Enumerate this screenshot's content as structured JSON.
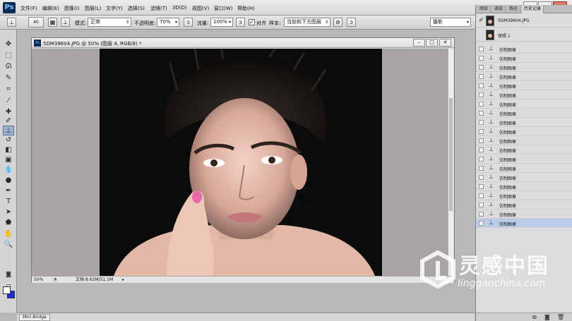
{
  "app": {
    "logo": "Ps",
    "menu": [
      "文件(F)",
      "编辑(E)",
      "图像(I)",
      "图层(L)",
      "文字(Y)",
      "选择(S)",
      "滤镜(T)",
      "3D(D)",
      "视图(V)",
      "窗口(W)",
      "帮助(H)"
    ],
    "window_buttons": [
      "–",
      "□",
      "✕"
    ]
  },
  "options_bar": {
    "brush_size": "40",
    "mode_label": "模式:",
    "mode_value": "正常",
    "opacity_label": "不透明度:",
    "opacity_value": "70%",
    "flow_label": "流量:",
    "flow_value": "100%",
    "aligned_label": "对齐",
    "sample_label": "样本:",
    "sample_value": "当前和下方图层",
    "workspace_value": "摄影"
  },
  "document": {
    "title": "5DM39604.JPG @ 50% (图层 4, RGB/8) *",
    "zoom": "50%",
    "doc_size": "文档:8.62M/51.1M",
    "buttons": [
      "–",
      "□",
      "✕"
    ]
  },
  "history_panel": {
    "tabs": [
      "图层",
      "通道",
      "路径",
      "历史记录"
    ],
    "active_tab": "历史记录",
    "snapshots": [
      "5DM39604.JPG",
      "快照 1"
    ],
    "steps": [
      "仿制图章",
      "仿制图章",
      "仿制图章",
      "仿制图章",
      "仿制图章",
      "仿制图章",
      "仿制图章",
      "仿制图章",
      "仿制图章",
      "仿制图章",
      "仿制图章",
      "仿制图章",
      "仿制图章",
      "仿制图章",
      "仿制图章",
      "仿制图章",
      "仿制图章",
      "仿制图章",
      "仿制图章",
      "仿制图章"
    ],
    "selected_step": 19
  },
  "bottom_panel": {
    "tab": "Mini Bridge"
  },
  "watermark": {
    "title": "灵感中国",
    "url": "lingganchina.com"
  },
  "colors": {
    "foreground": "#ffffff",
    "background": "#1b2bd8",
    "history_selection": "#b9cbe6"
  },
  "icons": [
    "move-icon",
    "marquee-icon",
    "lasso-icon",
    "quick-select-icon",
    "crop-icon",
    "eyedropper-icon",
    "healing-brush-icon",
    "brush-icon",
    "clone-stamp-icon",
    "history-brush-icon",
    "eraser-icon",
    "gradient-icon",
    "blur-icon",
    "dodge-icon",
    "pen-icon",
    "type-icon",
    "path-select-icon",
    "shape-icon",
    "hand-icon",
    "zoom-icon"
  ]
}
